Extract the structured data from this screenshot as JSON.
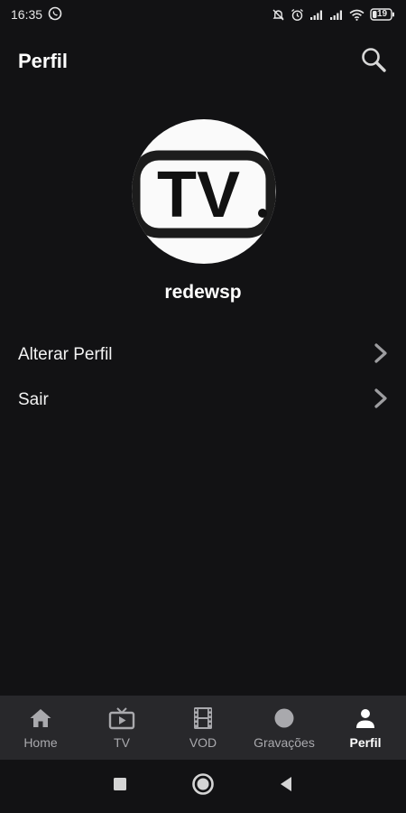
{
  "status_bar": {
    "time": "16:35",
    "battery": "19"
  },
  "header": {
    "title": "Perfil"
  },
  "profile": {
    "avatar_text": "TV",
    "username": "redewsp"
  },
  "menu": {
    "items": [
      {
        "label": "Alterar Perfil"
      },
      {
        "label": "Sair"
      }
    ]
  },
  "bottom_nav": {
    "items": [
      {
        "label": "Home",
        "icon": "home-icon"
      },
      {
        "label": "TV",
        "icon": "tv-icon"
      },
      {
        "label": "VOD",
        "icon": "film-icon"
      },
      {
        "label": "Gravações",
        "icon": "record-icon"
      },
      {
        "label": "Perfil",
        "icon": "person-icon",
        "active": true
      }
    ]
  },
  "colors": {
    "background": "#121214",
    "nav_background": "#28282b",
    "active": "#ffffff",
    "inactive": "#a9a9ad"
  }
}
